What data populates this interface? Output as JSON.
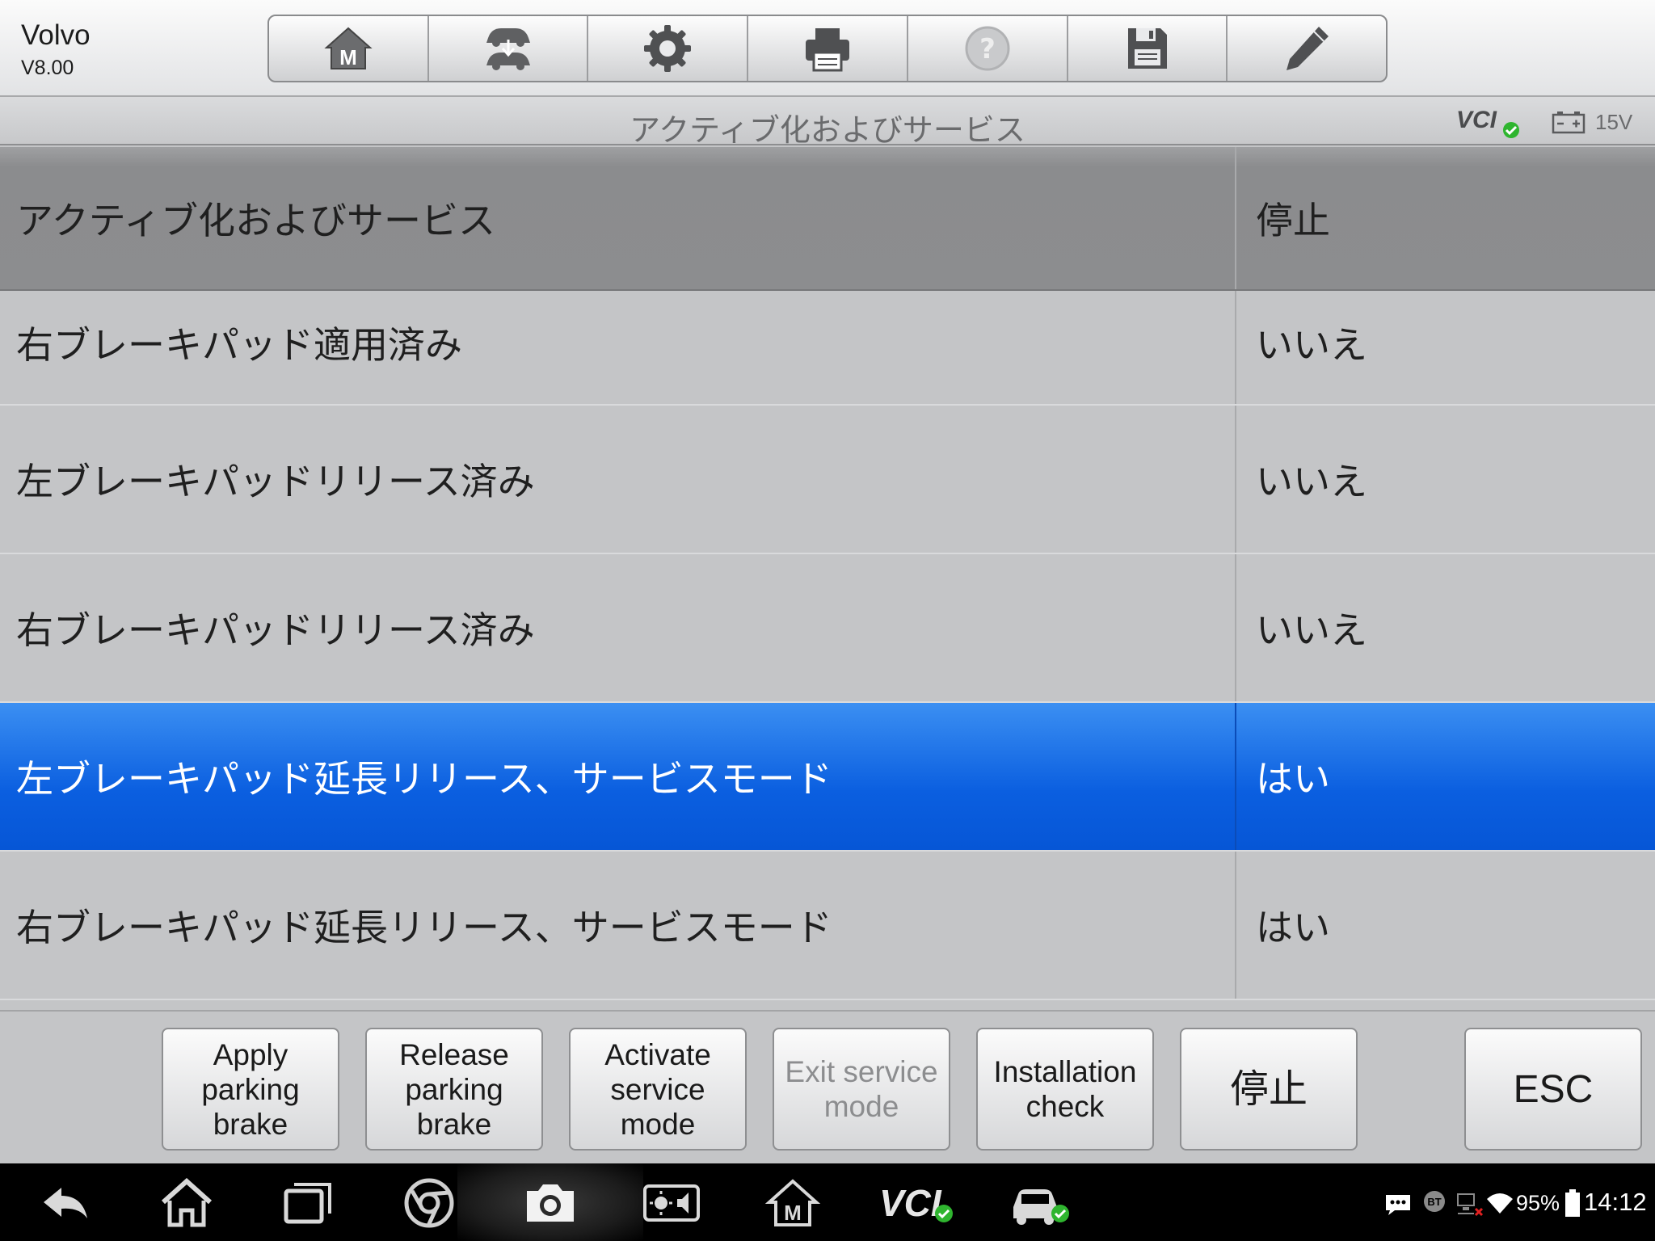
{
  "app": {
    "name": "Volvo",
    "version": "V8.00"
  },
  "toolbar": {
    "buttons": [
      {
        "icon": "home-m-icon"
      },
      {
        "icon": "vehicle-swap-icon"
      },
      {
        "icon": "gear-icon"
      },
      {
        "icon": "printer-icon"
      },
      {
        "icon": "help-icon",
        "disabled": true
      },
      {
        "icon": "save-icon"
      },
      {
        "icon": "pencil-icon"
      }
    ]
  },
  "title_bar": {
    "title": "アクティブ化およびサービス",
    "vci_label": "VCI",
    "voltage": "15V"
  },
  "table": {
    "header": {
      "name": "アクティブ化およびサービス",
      "value": "停止"
    },
    "rows": [
      {
        "name": "右ブレーキパッド適用済み",
        "value": "いいえ"
      },
      {
        "name": "左ブレーキパッドリリース済み",
        "value": "いいえ"
      },
      {
        "name": "右ブレーキパッドリリース済み",
        "value": "いいえ"
      },
      {
        "name": "左ブレーキパッド延長リリース、サービスモード",
        "value": "はい",
        "selected": true
      },
      {
        "name": "右ブレーキパッド延長リリース、サービスモード",
        "value": "はい"
      }
    ]
  },
  "actions": {
    "apply_parking_brake": [
      "Apply",
      "parking",
      "brake"
    ],
    "release_parking_brake": [
      "Release",
      "parking",
      "brake"
    ],
    "activate_service_mode": [
      "Activate",
      "service",
      "mode"
    ],
    "exit_service_mode": [
      "Exit service",
      "mode"
    ],
    "installation_check": [
      "Installation",
      "check"
    ],
    "stop": "停止",
    "esc": "ESC"
  },
  "nav_bar": {
    "vci_label": "VCI",
    "battery_percent": "95%",
    "time": "14:12",
    "bt_label": "BT"
  },
  "colors": {
    "selected_row": "#0b5fe0",
    "header_row": "#8c8d8f",
    "background": "#c4c5c7",
    "connected_check": "#2fb52f"
  }
}
